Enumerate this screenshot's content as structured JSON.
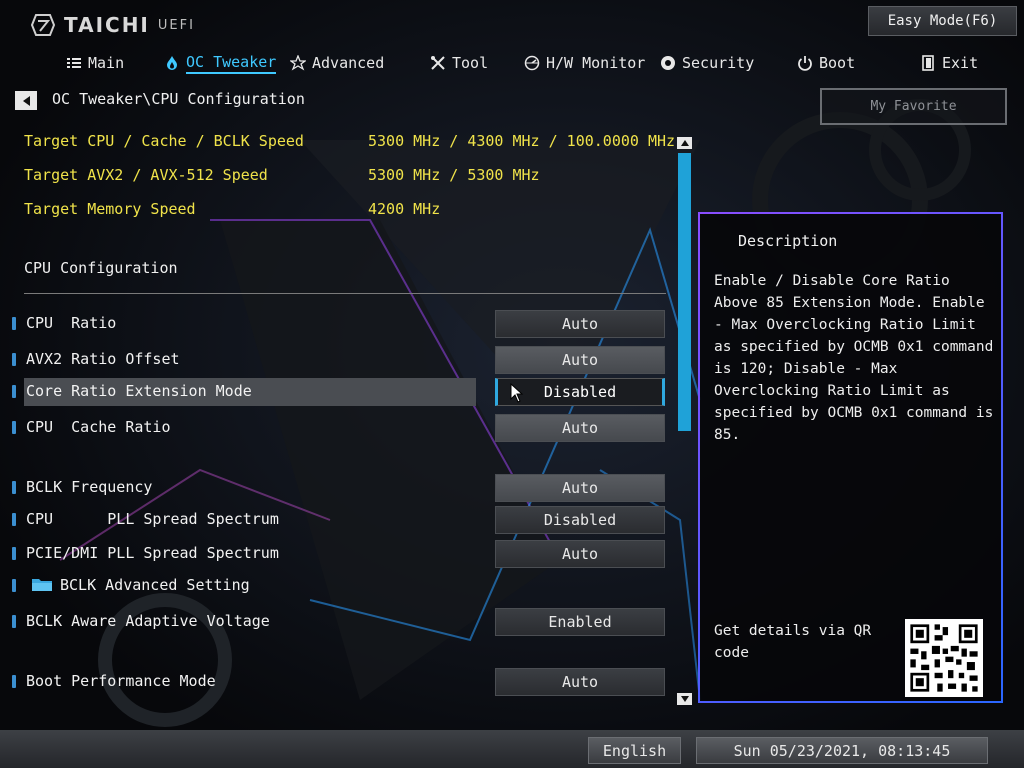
{
  "brand": {
    "name": "TAICHI",
    "suffix": "UEFI"
  },
  "easy_mode_label": "Easy Mode(F6)",
  "nav": {
    "tabs": [
      {
        "label": "Main",
        "icon": "list-icon"
      },
      {
        "label": "OC Tweaker",
        "icon": "flame-icon",
        "active": true
      },
      {
        "label": "Advanced",
        "icon": "star-icon"
      },
      {
        "label": "Tool",
        "icon": "tools-icon"
      },
      {
        "label": "H/W Monitor",
        "icon": "monitor-icon"
      },
      {
        "label": "Security",
        "icon": "shield-icon"
      },
      {
        "label": "Boot",
        "icon": "power-icon"
      },
      {
        "label": "Exit",
        "icon": "exit-icon"
      }
    ]
  },
  "breadcrumb": "OC Tweaker\\CPU Configuration",
  "favorite_label": "My Favorite",
  "info": [
    {
      "label": "Target CPU / Cache / BCLK Speed",
      "value": "5300 MHz / 4300 MHz / 100.0000 MHz"
    },
    {
      "label": "Target AVX2 / AVX-512 Speed",
      "value": "5300 MHz / 5300 MHz"
    },
    {
      "label": "Target Memory Speed",
      "value": "4200 MHz"
    }
  ],
  "section_title": "CPU Configuration",
  "settings": [
    {
      "label": "CPU  Ratio",
      "value": "Auto",
      "style": "normal"
    },
    {
      "label": "AVX2 Ratio Offset",
      "value": "Auto",
      "style": "gray"
    },
    {
      "label": "Core Ratio Extension Mode",
      "value": "Disabled",
      "style": "selected"
    },
    {
      "label": "CPU  Cache Ratio",
      "value": "Auto",
      "style": "gray"
    },
    {
      "label": "BCLK Frequency",
      "value": "Auto",
      "style": "gray"
    },
    {
      "label": "CPU      PLL Spread Spectrum",
      "value": "Disabled",
      "style": "normal"
    },
    {
      "label": "PCIE/DMI PLL Spread Spectrum",
      "value": "Auto",
      "style": "normal"
    },
    {
      "label": "BCLK Advanced Setting",
      "value": null,
      "style": "folder"
    },
    {
      "label": "BCLK Aware Adaptive Voltage",
      "value": "Enabled",
      "style": "normal"
    },
    {
      "label": "Boot Performance Mode",
      "value": "Auto",
      "style": "normal"
    }
  ],
  "description": {
    "title": "Description",
    "text": "Enable / Disable Core Ratio Above 85 Extension Mode. Enable - Max Overclocking Ratio Limit as specified by OCMB 0x1 command is 120; Disable - Max Overclocking Ratio Limit as specified by OCMB 0x1 command is 85.",
    "qr_text": "Get details via QR code"
  },
  "footer": {
    "language": "English",
    "datetime": "Sun 05/23/2021, 08:13:45"
  },
  "colors": {
    "accent": "#3fc9ff",
    "info_text": "#f0e34a",
    "scroll_thumb": "#1fa2d8",
    "panel_border": "#8a4dff"
  }
}
